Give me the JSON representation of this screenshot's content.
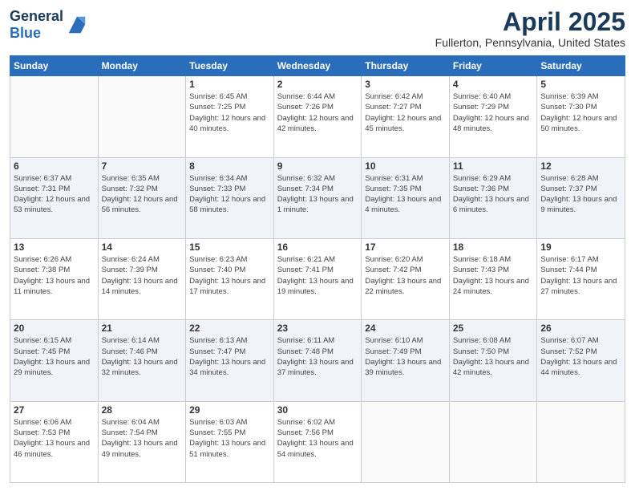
{
  "header": {
    "logo_line1": "General",
    "logo_line2": "Blue",
    "month": "April 2025",
    "location": "Fullerton, Pennsylvania, United States"
  },
  "days_of_week": [
    "Sunday",
    "Monday",
    "Tuesday",
    "Wednesday",
    "Thursday",
    "Friday",
    "Saturday"
  ],
  "weeks": [
    [
      {
        "day": "",
        "info": ""
      },
      {
        "day": "",
        "info": ""
      },
      {
        "day": "1",
        "info": "Sunrise: 6:45 AM\nSunset: 7:25 PM\nDaylight: 12 hours and 40 minutes."
      },
      {
        "day": "2",
        "info": "Sunrise: 6:44 AM\nSunset: 7:26 PM\nDaylight: 12 hours and 42 minutes."
      },
      {
        "day": "3",
        "info": "Sunrise: 6:42 AM\nSunset: 7:27 PM\nDaylight: 12 hours and 45 minutes."
      },
      {
        "day": "4",
        "info": "Sunrise: 6:40 AM\nSunset: 7:29 PM\nDaylight: 12 hours and 48 minutes."
      },
      {
        "day": "5",
        "info": "Sunrise: 6:39 AM\nSunset: 7:30 PM\nDaylight: 12 hours and 50 minutes."
      }
    ],
    [
      {
        "day": "6",
        "info": "Sunrise: 6:37 AM\nSunset: 7:31 PM\nDaylight: 12 hours and 53 minutes."
      },
      {
        "day": "7",
        "info": "Sunrise: 6:35 AM\nSunset: 7:32 PM\nDaylight: 12 hours and 56 minutes."
      },
      {
        "day": "8",
        "info": "Sunrise: 6:34 AM\nSunset: 7:33 PM\nDaylight: 12 hours and 58 minutes."
      },
      {
        "day": "9",
        "info": "Sunrise: 6:32 AM\nSunset: 7:34 PM\nDaylight: 13 hours and 1 minute."
      },
      {
        "day": "10",
        "info": "Sunrise: 6:31 AM\nSunset: 7:35 PM\nDaylight: 13 hours and 4 minutes."
      },
      {
        "day": "11",
        "info": "Sunrise: 6:29 AM\nSunset: 7:36 PM\nDaylight: 13 hours and 6 minutes."
      },
      {
        "day": "12",
        "info": "Sunrise: 6:28 AM\nSunset: 7:37 PM\nDaylight: 13 hours and 9 minutes."
      }
    ],
    [
      {
        "day": "13",
        "info": "Sunrise: 6:26 AM\nSunset: 7:38 PM\nDaylight: 13 hours and 11 minutes."
      },
      {
        "day": "14",
        "info": "Sunrise: 6:24 AM\nSunset: 7:39 PM\nDaylight: 13 hours and 14 minutes."
      },
      {
        "day": "15",
        "info": "Sunrise: 6:23 AM\nSunset: 7:40 PM\nDaylight: 13 hours and 17 minutes."
      },
      {
        "day": "16",
        "info": "Sunrise: 6:21 AM\nSunset: 7:41 PM\nDaylight: 13 hours and 19 minutes."
      },
      {
        "day": "17",
        "info": "Sunrise: 6:20 AM\nSunset: 7:42 PM\nDaylight: 13 hours and 22 minutes."
      },
      {
        "day": "18",
        "info": "Sunrise: 6:18 AM\nSunset: 7:43 PM\nDaylight: 13 hours and 24 minutes."
      },
      {
        "day": "19",
        "info": "Sunrise: 6:17 AM\nSunset: 7:44 PM\nDaylight: 13 hours and 27 minutes."
      }
    ],
    [
      {
        "day": "20",
        "info": "Sunrise: 6:15 AM\nSunset: 7:45 PM\nDaylight: 13 hours and 29 minutes."
      },
      {
        "day": "21",
        "info": "Sunrise: 6:14 AM\nSunset: 7:46 PM\nDaylight: 13 hours and 32 minutes."
      },
      {
        "day": "22",
        "info": "Sunrise: 6:13 AM\nSunset: 7:47 PM\nDaylight: 13 hours and 34 minutes."
      },
      {
        "day": "23",
        "info": "Sunrise: 6:11 AM\nSunset: 7:48 PM\nDaylight: 13 hours and 37 minutes."
      },
      {
        "day": "24",
        "info": "Sunrise: 6:10 AM\nSunset: 7:49 PM\nDaylight: 13 hours and 39 minutes."
      },
      {
        "day": "25",
        "info": "Sunrise: 6:08 AM\nSunset: 7:50 PM\nDaylight: 13 hours and 42 minutes."
      },
      {
        "day": "26",
        "info": "Sunrise: 6:07 AM\nSunset: 7:52 PM\nDaylight: 13 hours and 44 minutes."
      }
    ],
    [
      {
        "day": "27",
        "info": "Sunrise: 6:06 AM\nSunset: 7:53 PM\nDaylight: 13 hours and 46 minutes."
      },
      {
        "day": "28",
        "info": "Sunrise: 6:04 AM\nSunset: 7:54 PM\nDaylight: 13 hours and 49 minutes."
      },
      {
        "day": "29",
        "info": "Sunrise: 6:03 AM\nSunset: 7:55 PM\nDaylight: 13 hours and 51 minutes."
      },
      {
        "day": "30",
        "info": "Sunrise: 6:02 AM\nSunset: 7:56 PM\nDaylight: 13 hours and 54 minutes."
      },
      {
        "day": "",
        "info": ""
      },
      {
        "day": "",
        "info": ""
      },
      {
        "day": "",
        "info": ""
      }
    ]
  ]
}
